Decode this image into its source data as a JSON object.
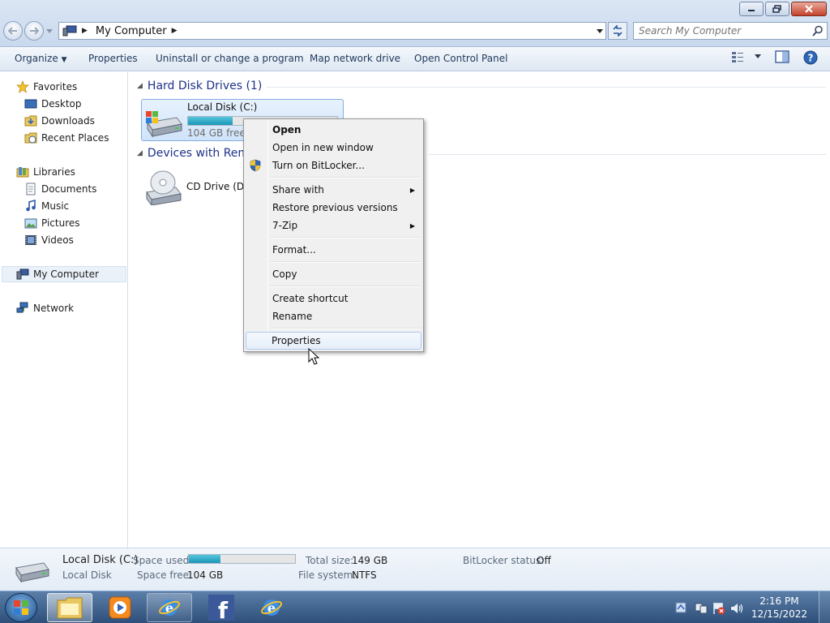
{
  "window": {
    "address": {
      "location": "My Computer"
    },
    "search": {
      "placeholder": "Search My Computer"
    }
  },
  "toolbar": {
    "organize": "Organize",
    "properties": "Properties",
    "uninstall": "Uninstall or change a program",
    "map_drive": "Map network drive",
    "control_panel": "Open Control Panel"
  },
  "sidebar": {
    "favorites": "Favorites",
    "favorites_items": [
      "Desktop",
      "Downloads",
      "Recent Places"
    ],
    "libraries": "Libraries",
    "library_items": [
      "Documents",
      "Music",
      "Pictures",
      "Videos"
    ],
    "computer": "My Computer",
    "network": "Network"
  },
  "content": {
    "hard_disk_header": "Hard Disk Drives (1)",
    "local_disk": {
      "name": "Local Disk (C:)",
      "free_text": "104 GB free o",
      "used_fraction": 0.3
    },
    "devices_header": "Devices with Remo",
    "cd_drive": {
      "name": "CD Drive (D:)"
    }
  },
  "context_menu": {
    "items": [
      {
        "label": "Open",
        "bold": true
      },
      {
        "label": "Open in new window"
      },
      {
        "label": "Turn on BitLocker...",
        "icon": "uac-shield-icon"
      },
      {
        "label": "Share with",
        "submenu": true
      },
      {
        "label": "Restore previous versions"
      },
      {
        "label": "7-Zip",
        "submenu": true
      },
      {
        "label": "Format..."
      },
      {
        "label": "Copy"
      },
      {
        "label": "Create shortcut"
      },
      {
        "label": "Rename"
      },
      {
        "label": "Properties",
        "highlighted": true
      }
    ]
  },
  "details": {
    "name": "Local Disk (C:)",
    "type": "Local Disk",
    "space_used_label": "Space used:",
    "space_used_fraction": 0.3,
    "space_free_label": "Space free:",
    "space_free": "104 GB",
    "total_size_label": "Total size:",
    "total_size": "149 GB",
    "file_system_label": "File system:",
    "file_system": "NTFS",
    "bitlocker_label": "BitLocker status:",
    "bitlocker_status": "Off"
  },
  "taskbar": {
    "items": [
      "windows-explorer-icon",
      "media-player-icon",
      "internet-explorer-icon",
      "facebook-icon",
      "internet-explorer-icon"
    ],
    "time": "2:16 PM",
    "date": "12/15/2022"
  },
  "colors": {
    "accent": "#1e3287",
    "usage_fill": "#1b95b7",
    "taskbar": "#2d4f7a"
  }
}
